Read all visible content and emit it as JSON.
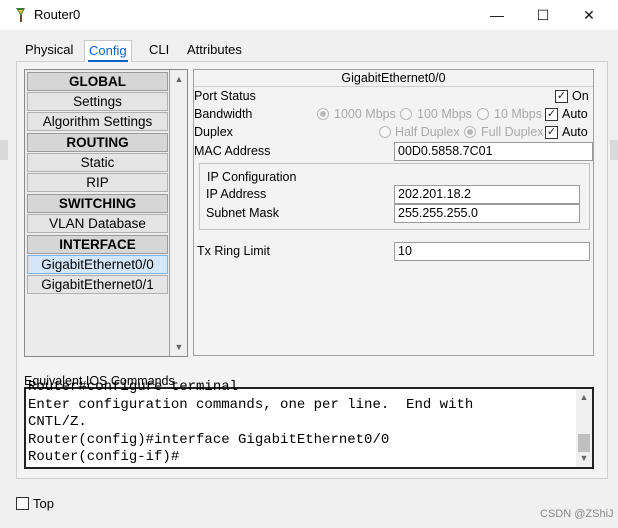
{
  "window": {
    "title": "Router0",
    "min_glyph": "—",
    "max_glyph": "☐",
    "close_glyph": "✕"
  },
  "tabs": [
    {
      "label": "Physical"
    },
    {
      "label": "Config",
      "active": true
    },
    {
      "label": "CLI"
    },
    {
      "label": "Attributes"
    }
  ],
  "sidebar": {
    "items": [
      {
        "label": "GLOBAL",
        "type": "header"
      },
      {
        "label": "Settings"
      },
      {
        "label": "Algorithm Settings"
      },
      {
        "label": "ROUTING",
        "type": "header"
      },
      {
        "label": "Static"
      },
      {
        "label": "RIP"
      },
      {
        "label": "SWITCHING",
        "type": "header"
      },
      {
        "label": "VLAN Database"
      },
      {
        "label": "INTERFACE",
        "type": "header"
      },
      {
        "label": "GigabitEthernet0/0",
        "selected": true
      },
      {
        "label": "GigabitEthernet0/1"
      }
    ]
  },
  "interface": {
    "title": "GigabitEthernet0/0",
    "port_status": {
      "label": "Port Status",
      "on_label": "On",
      "checked": true
    },
    "bandwidth": {
      "label": "Bandwidth",
      "options": [
        "1000 Mbps",
        "100 Mbps",
        "10 Mbps"
      ],
      "selected": "1000 Mbps",
      "auto_label": "Auto",
      "auto": true
    },
    "duplex": {
      "label": "Duplex",
      "options": [
        "Half Duplex",
        "Full Duplex"
      ],
      "selected": "Full Duplex",
      "auto_label": "Auto",
      "auto": true
    },
    "mac": {
      "label": "MAC Address",
      "value": "00D0.5858.7C01"
    },
    "ip_config": {
      "title": "IP Configuration",
      "ip_label": "IP Address",
      "ip_value": "202.201.18.2",
      "mask_label": "Subnet Mask",
      "mask_value": "255.255.255.0"
    },
    "tx_ring": {
      "label": "Tx Ring Limit",
      "value": "10"
    }
  },
  "ios": {
    "label": "Equivalent IOS Commands",
    "text": "Router#configure terminal\nEnter configuration commands, one per line.  End with\nCNTL/Z.\nRouter(config)#interface GigabitEthernet0/0\nRouter(config-if)#"
  },
  "footer": {
    "top_label": "Top",
    "top_checked": false,
    "watermark": "CSDN @ZShiJ"
  },
  "colors": {
    "accent": "#0b64c7",
    "selection": "#d4e7f8"
  }
}
